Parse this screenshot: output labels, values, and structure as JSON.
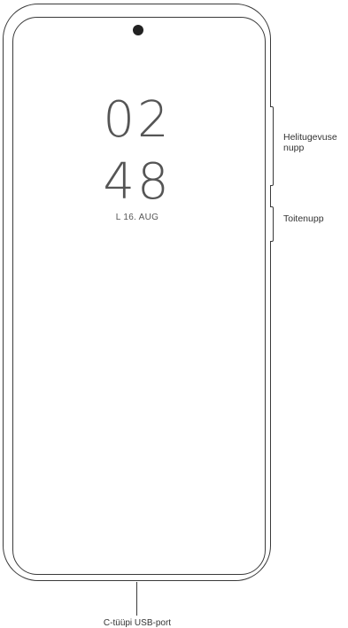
{
  "lockscreen": {
    "hours": "02",
    "minutes": "48",
    "date": "L 16. AUG"
  },
  "labels": {
    "volume_button": "Helitugevuse nupp",
    "power_button": "Toitenupp",
    "usb_port": "C-tüüpi USB-port"
  },
  "colors": {
    "outline": "#3a3a3a",
    "text": "#333333",
    "camera": "#222222"
  }
}
